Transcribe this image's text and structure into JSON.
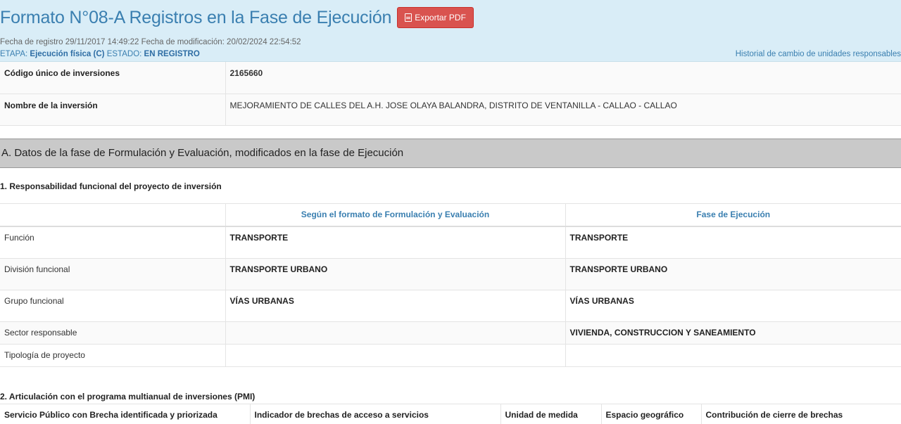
{
  "header": {
    "title": "Formato N°08-A Registros en la Fase de Ejecución",
    "export_label": "Exportar PDF",
    "export_icon": "pdf-file-icon",
    "fecha_registro_label": "Fecha de registro",
    "fecha_registro": "29/11/2017 14:49:22",
    "fecha_modificacion_label": "Fecha de modificación:",
    "fecha_modificacion": "20/02/2024 22:54:52",
    "etapa_label": "ETAPA:",
    "etapa_value": "Ejecución física (C)",
    "estado_label": "ESTADO:",
    "estado_value": "EN REGISTRO",
    "historial_link": "Historial de cambio de unidades responsables"
  },
  "info": {
    "codigo_label": "Código único de inversiones",
    "codigo_value": "2165660",
    "nombre_label": "Nombre de la inversión",
    "nombre_value": "MEJORAMIENTO DE CALLES DEL A.H. JOSE OLAYA BALANDRA, DISTRITO DE VENTANILLA - CALLAO - CALLAO"
  },
  "section_a": {
    "title": "A. Datos de la fase de Formulación y Evaluación, modificados en la fase de Ejecución",
    "sub1_title": "1. Responsabilidad funcional del proyecto de inversión",
    "columns": [
      "",
      "Según el formato de Formulación y Evaluación",
      "Fase de Ejecución"
    ],
    "rows": [
      {
        "label": "Función",
        "formulacion": "TRANSPORTE",
        "ejecucion": "TRANSPORTE"
      },
      {
        "label": "División funcional",
        "formulacion": "TRANSPORTE URBANO",
        "ejecucion": "TRANSPORTE URBANO"
      },
      {
        "label": "Grupo funcional",
        "formulacion": "VÍAS URBANAS",
        "ejecucion": "VÍAS URBANAS"
      },
      {
        "label": "Sector responsable",
        "formulacion": "",
        "ejecucion": "VIVIENDA, CONSTRUCCION Y SANEAMIENTO"
      },
      {
        "label": "Tipología de proyecto",
        "formulacion": "",
        "ejecucion": ""
      }
    ],
    "sub2_title": "2. Articulación con el programa multianual de inversiones (PMI)",
    "pmi_columns": [
      "Servicio Público con Brecha identificada y priorizada",
      "Indicador de brechas de acceso a servicios",
      "Unidad de medida",
      "Espacio geográfico",
      "Contribución de cierre de brechas"
    ]
  }
}
